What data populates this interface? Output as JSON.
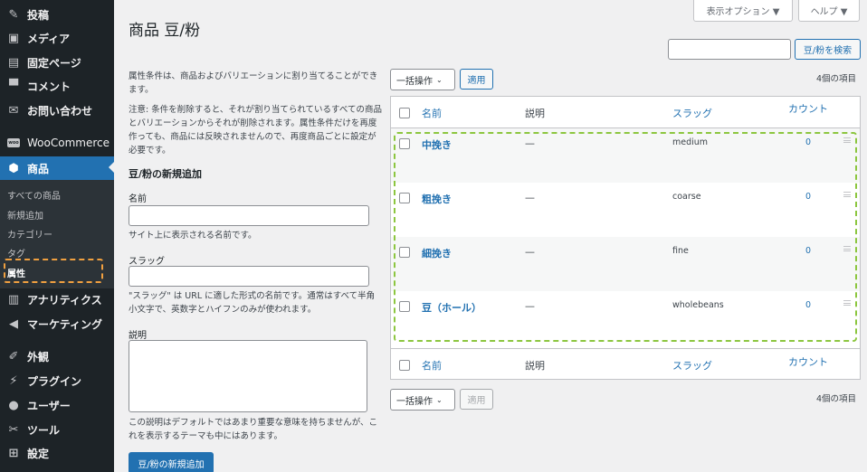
{
  "sidebar": {
    "items": [
      {
        "label": "投稿",
        "icon": "pin-icon"
      },
      {
        "label": "メディア",
        "icon": "media-icon"
      },
      {
        "label": "固定ページ",
        "icon": "page-icon"
      },
      {
        "label": "コメント",
        "icon": "comment-icon"
      },
      {
        "label": "お問い合わせ",
        "icon": "mail-icon"
      },
      {
        "label": "WooCommerce",
        "icon": "woocommerce-icon",
        "icon_text": "woo"
      },
      {
        "label": "商品",
        "icon": "product-icon"
      },
      {
        "label": "アナリティクス",
        "icon": "chart-icon"
      },
      {
        "label": "マーケティング",
        "icon": "megaphone-icon"
      },
      {
        "label": "外観",
        "icon": "brush-icon"
      },
      {
        "label": "プラグイン",
        "icon": "plugin-icon"
      },
      {
        "label": "ユーザー",
        "icon": "user-icon"
      },
      {
        "label": "ツール",
        "icon": "wrench-icon"
      },
      {
        "label": "設定",
        "icon": "settings-icon"
      }
    ],
    "submenu": [
      "すべての商品",
      "新規追加",
      "カテゴリー",
      "タグ",
      "属性"
    ]
  },
  "header": {
    "screen_options": "表示オプション ▼",
    "help": "ヘルプ ▼",
    "title": "商品 豆/粉"
  },
  "search": {
    "button": "豆/粉を検索",
    "value": ""
  },
  "form": {
    "intro": "属性条件は、商品およびバリエーションに割り当てることができます。",
    "note": "注意: 条件を削除すると、それが割り当てられているすべての商品とバリエーションからそれが削除されます。属性条件だけを再度作っても、商品には反映されませんので、再度商品ごとに設定が必要です。",
    "heading": "豆/粉の新規追加",
    "name_label": "名前",
    "name_help": "サイト上に表示される名前です。",
    "slug_label": "スラッグ",
    "slug_help": "\"スラッグ\" は URL に適した形式の名前です。通常はすべて半角小文字で、英数字とハイフンのみが使われます。",
    "desc_label": "説明",
    "desc_help": "この説明はデフォルトではあまり重要な意味を持ちませんが、これを表示するテーマも中にはあります。",
    "submit": "豆/粉の新規追加"
  },
  "bulk": {
    "select": "一括操作",
    "apply": "適用",
    "count": "4個の項目"
  },
  "table": {
    "columns": {
      "name": "名前",
      "description": "説明",
      "slug": "スラッグ",
      "count": "カウント"
    },
    "rows": [
      {
        "name": "中挽き",
        "description": "—",
        "slug": "medium",
        "count": "0"
      },
      {
        "name": "粗挽き",
        "description": "—",
        "slug": "coarse",
        "count": "0"
      },
      {
        "name": "細挽き",
        "description": "—",
        "slug": "fine",
        "count": "0"
      },
      {
        "name": "豆（ホール）",
        "description": "—",
        "slug": "wholebeans",
        "count": "0"
      }
    ]
  }
}
